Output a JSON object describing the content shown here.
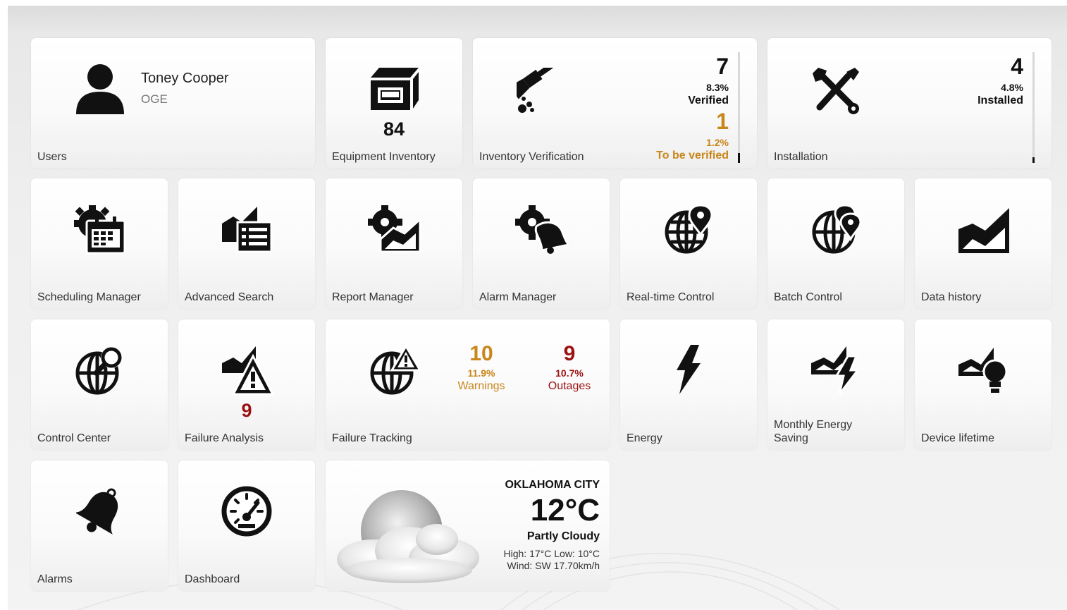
{
  "colors": {
    "gold": "#c9861b",
    "red": "#9b1212"
  },
  "users": {
    "label": "Users",
    "name": "Toney Cooper",
    "org": "OGE"
  },
  "equipment": {
    "label": "Equipment Inventory",
    "count": "84"
  },
  "verification": {
    "label": "Inventory Verification",
    "verified_count": "7",
    "verified_pct": "8.3%",
    "verified_label": "Verified",
    "pending_count": "1",
    "pending_pct": "1.2%",
    "pending_label": "To be verified",
    "progress": 0.09
  },
  "installation": {
    "label": "Installation",
    "count": "4",
    "pct": "4.8%",
    "status": "Installed",
    "progress": 0.05
  },
  "tiles": {
    "scheduling": "Scheduling Manager",
    "advanced_search": "Advanced Search",
    "report": "Report Manager",
    "alarm_manager": "Alarm Manager",
    "realtime": "Real-time Control",
    "batch": "Batch Control",
    "data_history": "Data history",
    "control_center": "Control Center",
    "energy": "Energy",
    "monthly_saving_line1": "Monthly Energy",
    "monthly_saving_line2": "Saving",
    "device_lifetime": "Device lifetime",
    "alarms": "Alarms",
    "dashboard": "Dashboard"
  },
  "failure_analysis": {
    "label": "Failure Analysis",
    "count": "9"
  },
  "failure_tracking": {
    "label": "Failure Tracking",
    "warnings_count": "10",
    "warnings_pct": "11.9%",
    "warnings_label": "Warnings",
    "outages_count": "9",
    "outages_pct": "10.7%",
    "outages_label": "Outages"
  },
  "weather": {
    "city": "OKLAHOMA CITY",
    "temp": "12°C",
    "condition": "Partly Cloudy",
    "high_low": "High: 17°C Low: 10°C",
    "wind": "Wind: SW 17.70km/h"
  }
}
